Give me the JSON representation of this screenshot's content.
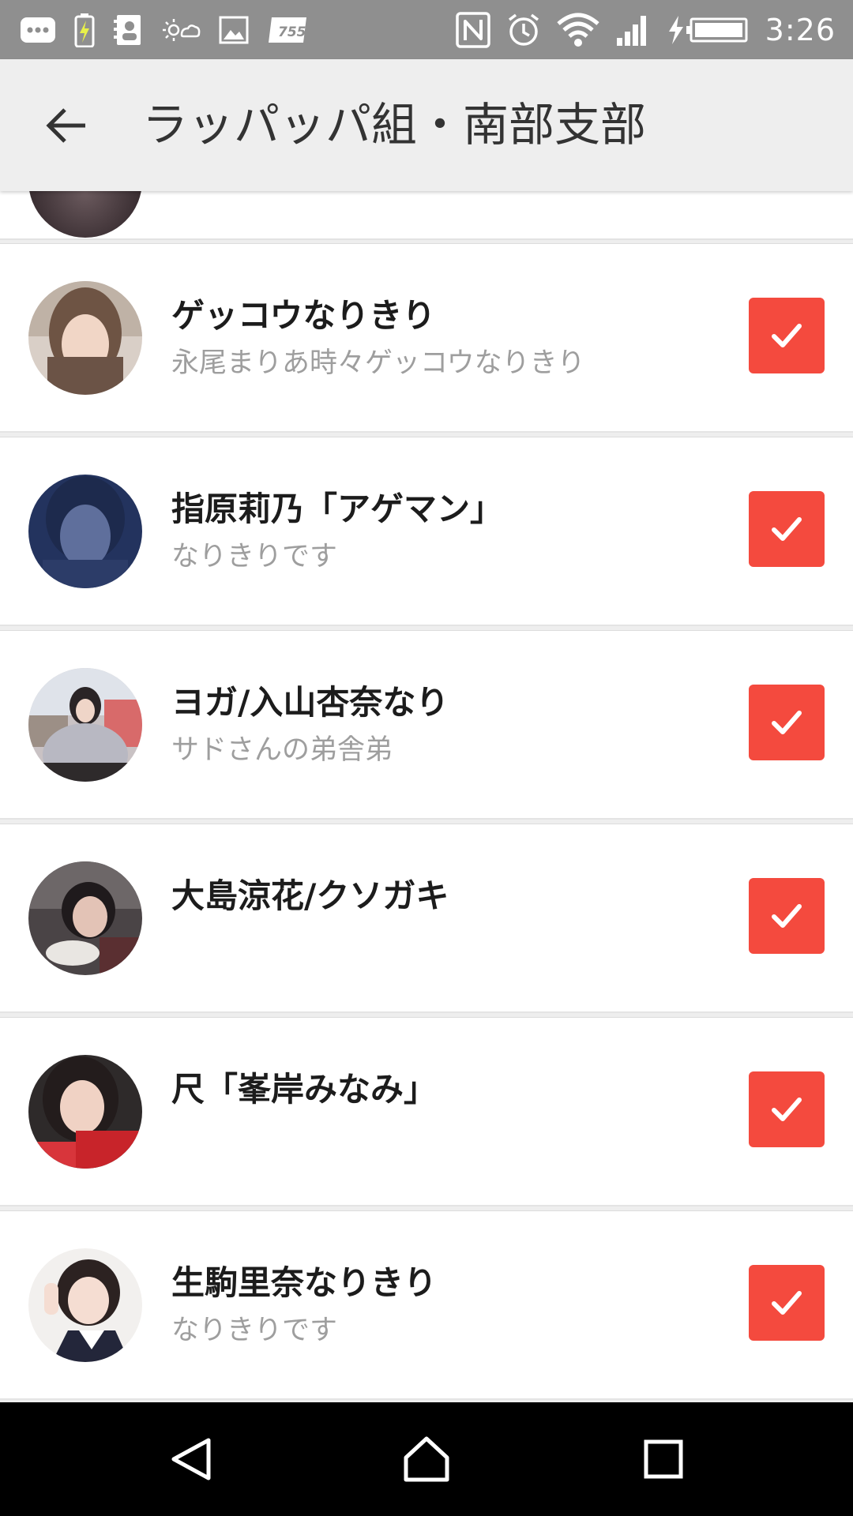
{
  "status_bar": {
    "time": "3:26",
    "app_icon_text": "755",
    "left_icons": [
      "chat-bubble-icon",
      "battery-charging-icon",
      "contacts-icon",
      "weather-icon",
      "gallery-icon",
      "755-app-icon"
    ],
    "right_icons": [
      "nfc-icon",
      "alarm-icon",
      "wifi-icon",
      "signal-icon",
      "battery-charging-icon"
    ],
    "background": "#8f8f8f"
  },
  "app_bar": {
    "title": "ラッパッパ組・南部支部",
    "back_icon": "arrow-back-icon",
    "background": "#eeeeee"
  },
  "members": [
    {
      "name": "ゲッコウなりきり",
      "subtitle": "永尾まりあ時々ゲッコウなりきり",
      "checked": true,
      "avatar_icon": "avatar-photo"
    },
    {
      "name": "指原莉乃「アゲマン」",
      "subtitle": "なりきりです",
      "checked": true,
      "avatar_icon": "avatar-photo"
    },
    {
      "name": "ヨガ/入山杏奈なり",
      "subtitle": "サドさんの弟舎弟",
      "checked": true,
      "avatar_icon": "avatar-photo"
    },
    {
      "name": "大島涼花/クソガキ",
      "subtitle": "",
      "checked": true,
      "avatar_icon": "avatar-photo"
    },
    {
      "name": "尺「峯岸みなみ」",
      "subtitle": "",
      "checked": true,
      "avatar_icon": "avatar-photo"
    },
    {
      "name": "生駒里奈なりきり",
      "subtitle": "なりきりです",
      "checked": true,
      "avatar_icon": "avatar-photo"
    }
  ],
  "colors": {
    "checkbox": "#f44a3e",
    "name_text": "#1c1c1c",
    "subtitle_text": "#9e9e9e"
  },
  "nav_bar": {
    "icons": [
      "back-triangle-icon",
      "home-icon",
      "recents-icon"
    ]
  }
}
